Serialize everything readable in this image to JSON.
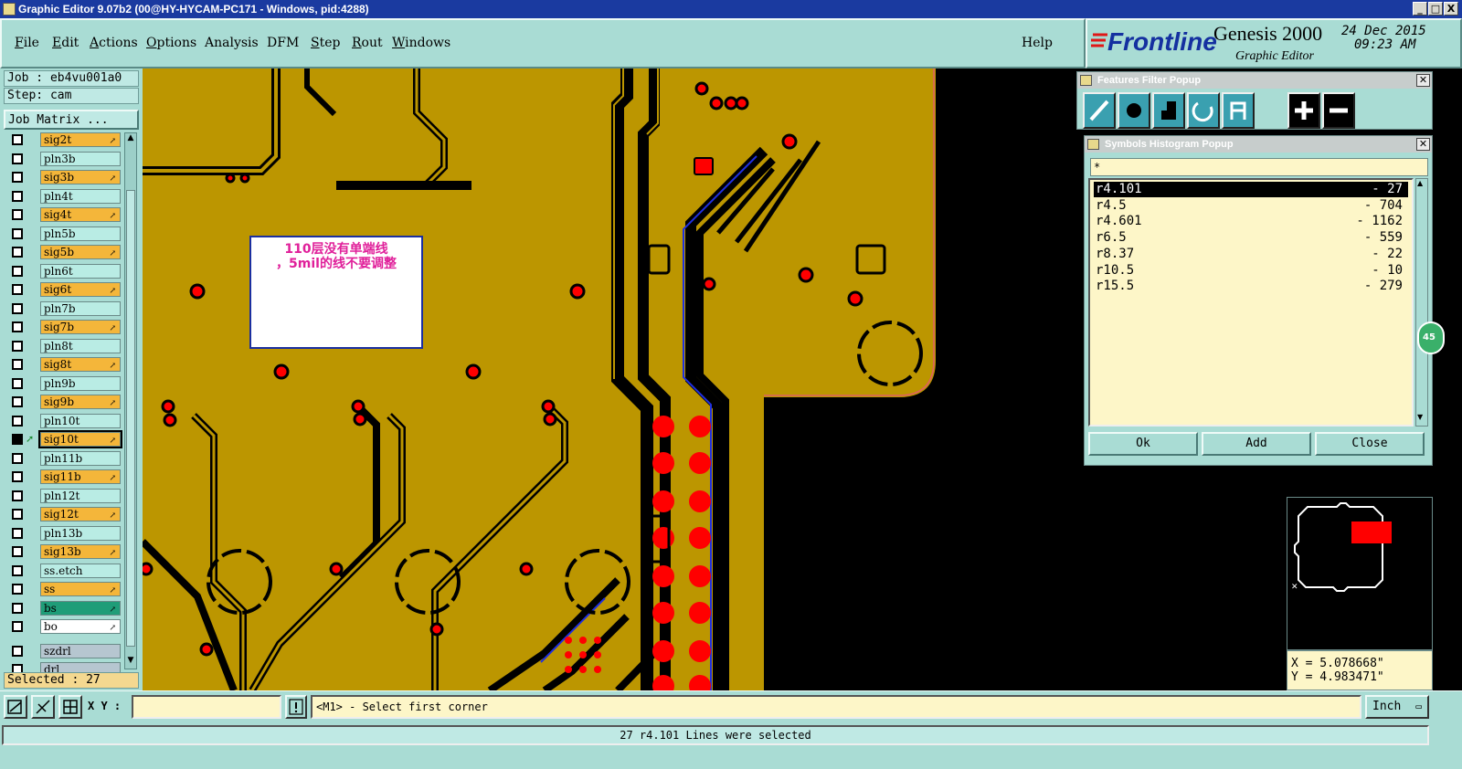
{
  "window": {
    "title": "Graphic Editor 9.07b2 (00@HY-HYCAM-PC171 - Windows, pid:4288)",
    "controls": [
      "_",
      "□",
      "X"
    ]
  },
  "menu": {
    "items": [
      {
        "label": "File",
        "underline": "F",
        "rest": "ile"
      },
      {
        "label": "Edit",
        "underline": "E",
        "rest": "dit"
      },
      {
        "label": "Actions",
        "underline": "A",
        "rest": "ctions"
      },
      {
        "label": "Options",
        "underline": "O",
        "rest": "ptions"
      },
      {
        "label": "Analysis",
        "underline": "",
        "rest": "Analysis"
      },
      {
        "label": "DFM",
        "underline": "",
        "rest": "DFM"
      },
      {
        "label": "Step",
        "underline": "S",
        "rest": "tep"
      },
      {
        "label": "Rout",
        "underline": "R",
        "rest": "out"
      },
      {
        "label": "Windows",
        "underline": "W",
        "rest": "indows"
      }
    ],
    "help": "Help"
  },
  "brand": {
    "logo": "Frontline",
    "product": "Genesis 2000",
    "subtitle": "Graphic Editor",
    "date": "24 Dec 2015",
    "time": "09:23 AM"
  },
  "job": {
    "job_line": "Job : eb4vu001a0",
    "step_line": "Step: cam",
    "matrix_button": "Job Matrix ..."
  },
  "layers": [
    {
      "name": "sig2t",
      "type": "sig"
    },
    {
      "name": "pln3b",
      "type": "pln"
    },
    {
      "name": "sig3b",
      "type": "sig"
    },
    {
      "name": "pln4t",
      "type": "pln"
    },
    {
      "name": "sig4t",
      "type": "sig"
    },
    {
      "name": "pln5b",
      "type": "pln"
    },
    {
      "name": "sig5b",
      "type": "sig"
    },
    {
      "name": "pln6t",
      "type": "pln"
    },
    {
      "name": "sig6t",
      "type": "sig"
    },
    {
      "name": "pln7b",
      "type": "pln"
    },
    {
      "name": "sig7b",
      "type": "sig"
    },
    {
      "name": "pln8t",
      "type": "pln"
    },
    {
      "name": "sig8t",
      "type": "sig"
    },
    {
      "name": "pln9b",
      "type": "pln"
    },
    {
      "name": "sig9b",
      "type": "sig"
    },
    {
      "name": "pln10t",
      "type": "pln"
    },
    {
      "name": "sig10t",
      "type": "active"
    },
    {
      "name": "pln11b",
      "type": "pln"
    },
    {
      "name": "sig11b",
      "type": "sig"
    },
    {
      "name": "pln12t",
      "type": "pln"
    },
    {
      "name": "sig12t",
      "type": "sig"
    },
    {
      "name": "pln13b",
      "type": "pln"
    },
    {
      "name": "sig13b",
      "type": "sig"
    },
    {
      "name": "ss.etch",
      "type": "etc"
    },
    {
      "name": "ss",
      "type": "sig"
    },
    {
      "name": "bs",
      "type": "bs"
    },
    {
      "name": "bo",
      "type": "bo"
    },
    {
      "name": "szdrl",
      "type": "drl"
    },
    {
      "name": "drl",
      "type": "drl"
    }
  ],
  "selected_text": "Selected : 27",
  "note": {
    "line1": "110层没有单端线",
    "line2": "，5mil的线不要调整"
  },
  "features_filter": {
    "title": "Features Filter Popup",
    "tools": [
      "line-tool-icon",
      "pad-tool-icon",
      "surface-tool-icon",
      "arc-tool-icon",
      "text-tool-icon",
      "plus-icon",
      "minus-icon"
    ]
  },
  "histogram": {
    "title": "Symbols Histogram Popup",
    "filter": "*",
    "rows": [
      {
        "symbol": "r4.101",
        "count": "- 27",
        "selected": true
      },
      {
        "symbol": "r4.5",
        "count": "- 704",
        "selected": false
      },
      {
        "symbol": "r4.601",
        "count": "- 1162",
        "selected": false
      },
      {
        "symbol": "r6.5",
        "count": "- 559",
        "selected": false
      },
      {
        "symbol": "r8.37",
        "count": "- 22",
        "selected": false
      },
      {
        "symbol": "r10.5",
        "count": "- 10",
        "selected": false
      },
      {
        "symbol": "r15.5",
        "count": "- 279",
        "selected": false
      }
    ],
    "buttons": {
      "ok": "Ok",
      "add": "Add",
      "close": "Close"
    }
  },
  "coords": {
    "x": "X = 5.078668\"",
    "y": "Y = 4.983471\""
  },
  "bottom": {
    "xy_label": "X Y :",
    "xy_value": "",
    "prompt": "<M1> - Select first corner",
    "unit": "Inch"
  },
  "status_message": "27 r4.101 Lines were selected",
  "overview_badge": "45",
  "colors": {
    "copper": "#bc9600",
    "pad": "#ff0000",
    "trace": "#000000",
    "highlight_trace": "#2030e0"
  }
}
